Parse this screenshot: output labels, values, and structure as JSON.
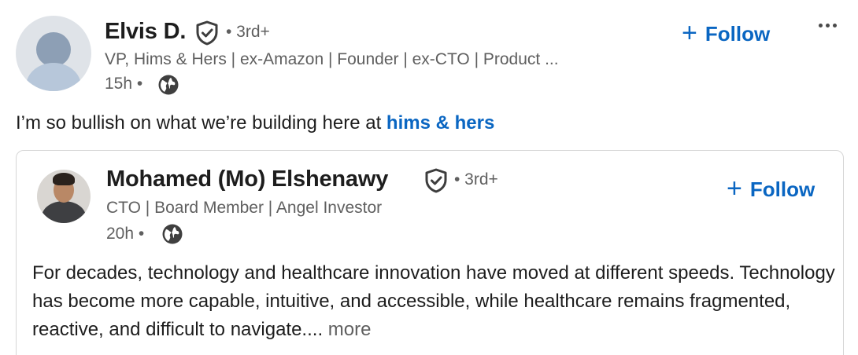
{
  "post": {
    "author": {
      "name": "Elvis D.",
      "degree": "• 3rd+",
      "headline": "VP, Hims & Hers | ex-Amazon | Founder | ex-CTO | Product ...",
      "time": "15h •"
    },
    "follow_label": "Follow",
    "follow_icon": "+",
    "commentary": {
      "text": "I’m so bullish on what we’re building here at ",
      "hashtag": "hims & hers"
    }
  },
  "reshared": {
    "author": {
      "name": "Mohamed (Mo) Elshenawy",
      "degree": "• 3rd+",
      "headline": "CTO | Board Member | Angel Investor",
      "time": "20h •"
    },
    "follow_label": "Follow",
    "follow_icon": "+",
    "body": {
      "text": "For decades, technology and healthcare innovation have moved at different speeds. Technology has become more capable, intuitive, and accessible, while healthcare remains fragmented, reactive, and difficult to navigate.... ",
      "more_label": "more"
    }
  },
  "icons": {
    "verified": "verified-shield-icon",
    "globe": "globe-icon",
    "more": "more-options-icon"
  },
  "colors": {
    "accent": "#0a66c2",
    "muted": "#5f5f5f",
    "text": "#1d1d1d"
  }
}
